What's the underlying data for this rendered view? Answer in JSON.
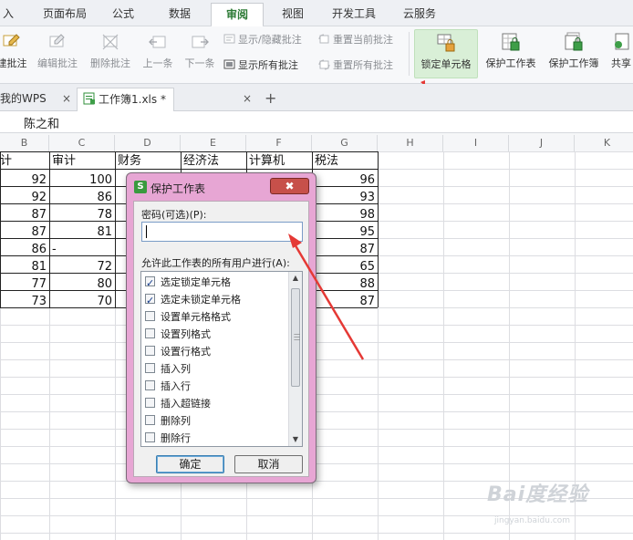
{
  "ribbon_tabs": [
    {
      "label": "入"
    },
    {
      "label": "页面布局"
    },
    {
      "label": "公式"
    },
    {
      "label": "数据"
    },
    {
      "label": "审阅"
    },
    {
      "label": "视图"
    },
    {
      "label": "开发工具"
    },
    {
      "label": "云服务"
    }
  ],
  "active_tab": "审阅",
  "ribbon": {
    "insert_comment": "建批注",
    "edit_comment": "编辑批注",
    "delete_comment": "删除批注",
    "previous": "上一条",
    "next": "下一条",
    "show_hide_comment": "显示/隐藏批注",
    "show_all_comments": "显示所有批注",
    "reset_current_comment": "重置当前批注",
    "reset_all_comments": "重置所有批注",
    "lock_cell": "锁定单元格",
    "protect_sheet": "保护工作表",
    "protect_workbook": "保护工作簿",
    "share": "共享"
  },
  "doc_tabs": {
    "my_wps": "我的WPS",
    "workbook": "工作簿1.xls *",
    "close_glyph": "×",
    "new_tab_glyph": "+"
  },
  "formula_bar": {
    "content": "陈之和"
  },
  "columns": [
    "B",
    "C",
    "D",
    "E",
    "F",
    "G",
    "H",
    "I",
    "J",
    "K"
  ],
  "sheet": {
    "headers": [
      "计",
      "审计",
      "财务",
      "经济法",
      "计算机",
      "税法"
    ],
    "col_b": [
      "92",
      "92",
      "87",
      "87",
      "86",
      "81",
      "77",
      "73"
    ],
    "col_c": [
      "100",
      "86",
      "78",
      "81",
      "-",
      "72",
      "80",
      "70"
    ],
    "col_g": [
      "96",
      "93",
      "98",
      "95",
      "87",
      "65",
      "88",
      "87"
    ]
  },
  "dialog": {
    "logo": "S",
    "title": "保护工作表",
    "close": "✖",
    "password_label": "密码(可选)(P):",
    "password_value": "",
    "permissions_label": "允许此工作表的所有用户进行(A):",
    "permissions": [
      {
        "label": "选定锁定单元格",
        "checked": true
      },
      {
        "label": "选定未锁定单元格",
        "checked": true
      },
      {
        "label": "设置单元格格式",
        "checked": false
      },
      {
        "label": "设置列格式",
        "checked": false
      },
      {
        "label": "设置行格式",
        "checked": false
      },
      {
        "label": "插入列",
        "checked": false
      },
      {
        "label": "插入行",
        "checked": false
      },
      {
        "label": "插入超链接",
        "checked": false
      },
      {
        "label": "删除列",
        "checked": false
      },
      {
        "label": "删除行",
        "checked": false
      }
    ],
    "ok": "确定",
    "cancel": "取消"
  },
  "watermark": {
    "brand": "Bai度经验",
    "url": "jingyan.baidu.com"
  },
  "colors": {
    "accent_green": "#2c7a35",
    "dialog_frame": "#e7a6d4",
    "arrow_red": "#e53935"
  }
}
